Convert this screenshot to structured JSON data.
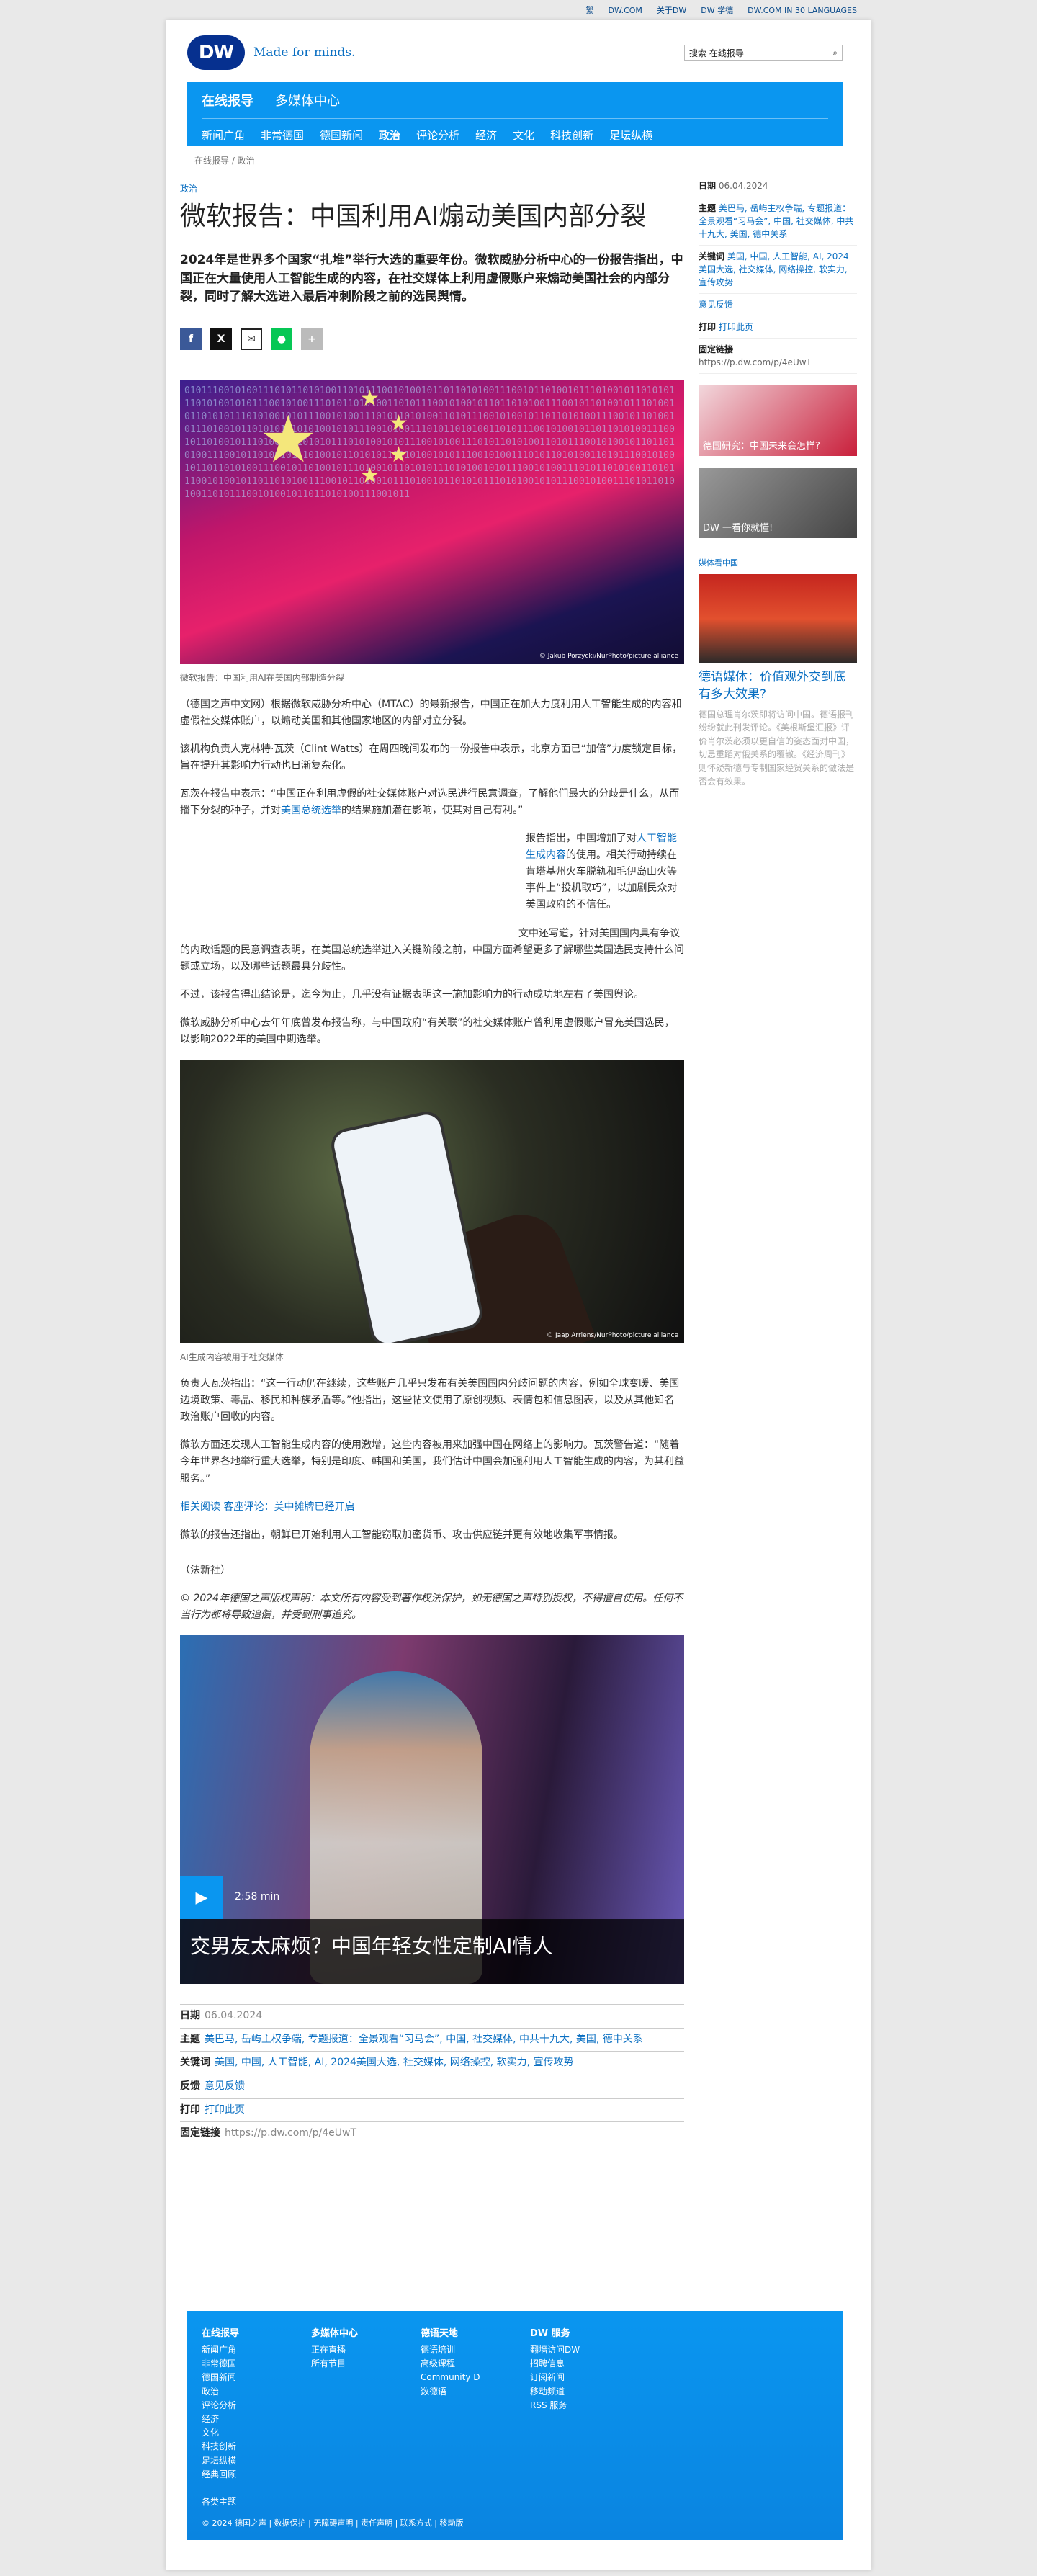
{
  "topbar": [
    "繁",
    "DW.COM",
    "关于DW",
    "DW 学德",
    "DW.COM IN 30 LANGUAGES"
  ],
  "brand": {
    "logo": "DW",
    "slogan": "Made for minds."
  },
  "search": {
    "placeholder": "搜索 在线报导"
  },
  "nav": {
    "top": [
      "在线报导",
      "多媒体中心"
    ],
    "sub": [
      "新闻广角",
      "非常德国",
      "德国新闻",
      "政治",
      "评论分析",
      "经济",
      "文化",
      "科技创新",
      "足坛纵横"
    ]
  },
  "breadcrumb": "在线报导 / 政治",
  "article": {
    "kicker": "政治",
    "title": "微软报告：中国利用AI煽动美国内部分裂",
    "lead": "2024年是世界多个国家“扎堆”举行大选的重要年份。微软威胁分析中心的一份报告指出，中国正在大量使用人工智能生成的内容，在社交媒体上利用虚假账户来煽动美国社会的内部分裂，同时了解大选进入最后冲刺阶段之前的选民舆情。",
    "hero_credit": "© Jakub Porzycki/NurPhoto/picture alliance",
    "hero_caption": "微软报告：中国利用AI在美国内部制造分裂",
    "p1": "（德国之声中文网）根据微软威胁分析中心（MTAC）的最新报告，中国正在加大力度利用人工智能生成的内容和虚假社交媒体账户，以煽动美国和其他国家地区的内部对立分裂。",
    "p2": "该机构负责人克林特·瓦茨（Clint Watts）在周四晚间发布的一份报告中表示，北京方面已“加倍”力度锁定目标，旨在提升其影响力行动也日渐复杂化。",
    "p3a": "瓦茨在报告中表示：“中国正在利用虚假的社交媒体账户对选民进行民意调查，了解他们最大的分歧是什么，从而播下分裂的种子，并对",
    "p3link": "美国总统选举",
    "p3b": "的结果施加潜在影响，使其对自己有利。”",
    "p4a": "报告指出，中国增加了对",
    "p4link": "人工智能生成内容",
    "p4b": "的使用。相关行动持续在肯塔基州火车脱轨和毛伊岛山火等事件上“投机取巧”，以加剧民众对美国政府的不信任。",
    "p5": "文中还写道，针对美国国内具有争议的内政话题的民意调查表明，在美国总统选举进入关键阶段之前，中国方面希望更多了解哪些美国选民支持什么问题或立场，以及哪些话题最具分歧性。",
    "p6": "不过，该报告得出结论是，迄今为止，几乎没有证据表明这一施加影响力的行动成功地左右了美国舆论。",
    "p7": "微软威胁分析中心去年年底曾发布报告称，与中国政府“有关联”的社交媒体账户曾利用虚假账户冒充美国选民，以影响2022年的美国中期选举。",
    "phone_credit": "© Jaap Arriens/NurPhoto/picture alliance",
    "phone_caption": "AI生成内容被用于社交媒体",
    "p8": "负责人瓦茨指出：“这一行动仍在继续，这些账户几乎只发布有关美国国内分歧问题的内容，例如全球变暖、美国边境政策、毒品、移民和种族矛盾等。”他指出，这些帖文使用了原创视频、表情包和信息图表，以及从其他知名政治账户回收的内容。",
    "p9": "微软方面还发现人工智能生成内容的使用激增，这些内容被用来加强中国在网络上的影响力。瓦茨警告道：“随着今年世界各地举行重大选举，特别是印度、韩国和美国，我们估计中国会加强利用人工智能生成的内容，为其利益服务。”",
    "related_label": "相关阅读 客座评论：",
    "related_link": "美中摊牌已经开启",
    "p10": "微软的报告还指出，朝鲜已开始利用人工智能窃取加密货币、攻击供应链并更有效地收集军事情报。",
    "source": "（法新社）",
    "copyright": "© 2024年德国之声版权声明：本文所有内容受到著作权法保护，如无德国之声特别授权，不得擅自使用。任何不当行为都将导致追偿，并受到刑事追究。",
    "video_duration": "2:58 min",
    "video_title": "交男友太麻烦？中国年轻女性定制AI情人"
  },
  "meta": {
    "date_label": "日期",
    "date": "06.04.2024",
    "topics_label": "主题",
    "topics": "美巴马, 岳屿主权争端, 专题报道：全景观看“习马会”, 中国, 社交媒体, 中共十九大, 美国, 德中关系",
    "keywords_label": "关键词",
    "keywords": "美国, 中国, 人工智能, AI, 2024美国大选, 社交媒体, 网络操控, 软实力, 宣传攻势",
    "feedback_label": "反馈",
    "feedback": "意见反馈",
    "print_label": "打印",
    "print": "打印此页",
    "link_label": "固定链接",
    "link": "https://p.dw.com/p/4eUwT"
  },
  "sidebar": {
    "date_label": "日期",
    "date": "06.04.2024",
    "topics_label": "主题",
    "topics": "美巴马, 岳屿主权争端, 专题报道：全景观看“习马会”, 中国, 社交媒体, 中共十九大, 美国, 德中关系",
    "keywords_label": "关键词",
    "keywords": "美国, 中国, 人工智能, AI, 2024美国大选, 社交媒体, 网络操控, 软实力, 宣传攻势",
    "feedback": "意见反馈",
    "print_label": "打印",
    "print": "打印此页",
    "link_label": "固定链接",
    "link": "https://p.dw.com/p/4eUwT",
    "thumb1": "德国研究：中国未来会怎样?",
    "thumb2": "DW 一看你就懂!",
    "section": "媒体看中国",
    "side_title": "德语媒体：价值观外交到底有多大效果?",
    "side_body": "德国总理肖尔茨即将访问中国。德语报刊纷纷就此刊发评论。《美根斯堡汇报》评价肖尔茨必须以更自信的姿态面对中国，切忌重蹈对俄关系的覆辙。《经济周刊》则怀疑新德与专制国家经贸关系的做法是否会有效果。"
  },
  "footer": {
    "cols": [
      {
        "title": "在线报导",
        "items": [
          "新闻广角",
          "非常德国",
          "德国新闻",
          "政治",
          "评论分析",
          "经济",
          "文化",
          "科技创新",
          "足坛纵横",
          "经典回顾",
          "",
          "各类主题"
        ]
      },
      {
        "title": "多媒体中心",
        "items": [
          "正在直播",
          "所有节目"
        ]
      },
      {
        "title": "德语天地",
        "items": [
          "德语培训",
          "高级课程",
          "Community D",
          "数德语"
        ]
      },
      {
        "title": "DW 服务",
        "items": [
          "翻墙访问DW",
          "招聘信息",
          "订阅新闻",
          "移动频道",
          "RSS 服务"
        ]
      }
    ],
    "bottom": "© 2024 德国之声 | 数据保护 | 无障碍声明 | 责任声明 | 联系方式 | 移动版"
  },
  "colors": {
    "brand_blue": "#0a96f0",
    "logo_blue": "#06308f",
    "link": "#0a6fc2"
  }
}
